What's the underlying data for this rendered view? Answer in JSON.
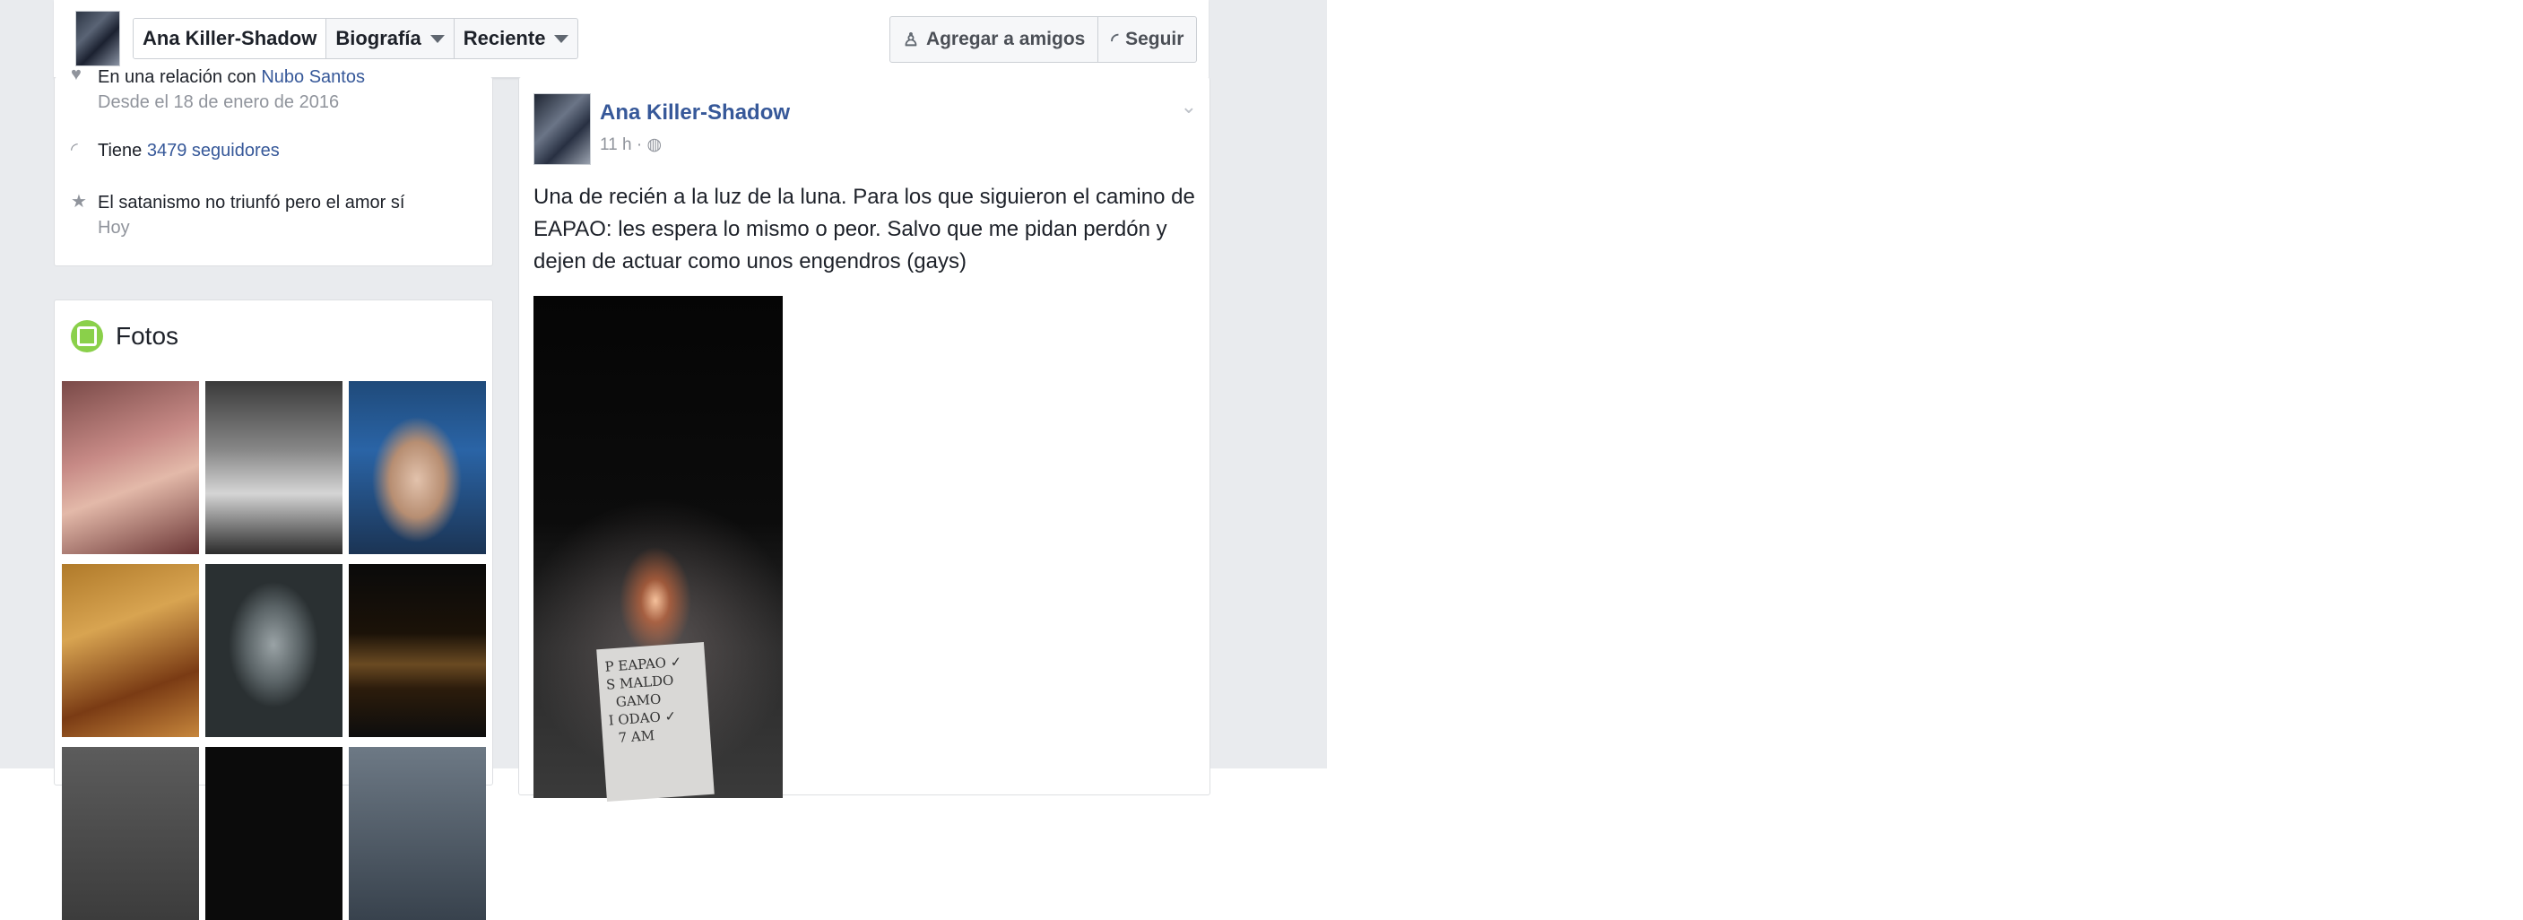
{
  "header": {
    "profile_name": "Ana Killer-Shadow",
    "biography_label": "Biografía",
    "recent_label": "Reciente",
    "add_friend_label": "Agregar a amigos",
    "follow_label": "Seguir"
  },
  "intro": {
    "relationship_text": "En una relación con ",
    "relationship_partner": "Nubo Santos",
    "relationship_since": "Desde el 18 de enero de 2016",
    "followers_prefix": "Tiene ",
    "followers_link": "3479 seguidores",
    "event_text": "El satanismo no triunfó pero el amor sí",
    "event_date": "Hoy"
  },
  "photos": {
    "title": "Fotos"
  },
  "post": {
    "author": "Ana Killer-Shadow",
    "time": "11 h · ",
    "text": "Una de recién a la luz de la luna. Para los que siguieron el camino de EAPAO: les espera lo mismo o peor. Salvo que me pidan perdón y dejen de actuar como unos engendros (gays)"
  }
}
